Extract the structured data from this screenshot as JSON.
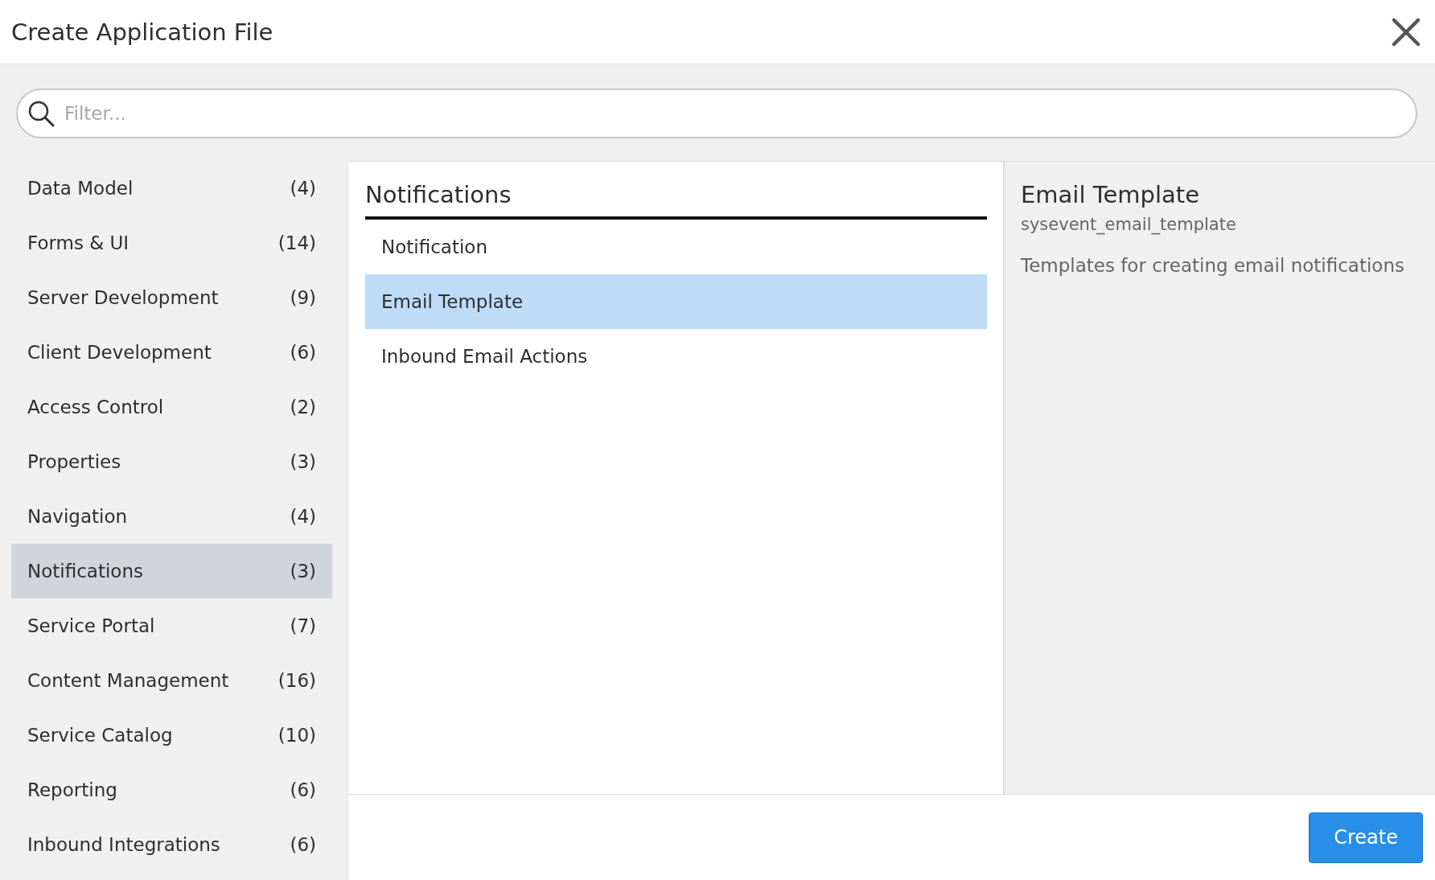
{
  "window": {
    "title": "Create Application File"
  },
  "search": {
    "placeholder": "Filter..."
  },
  "categories": [
    {
      "label": "Data Model",
      "count": "(4)",
      "selected": false
    },
    {
      "label": "Forms & UI",
      "count": "(14)",
      "selected": false
    },
    {
      "label": "Server Development",
      "count": "(9)",
      "selected": false
    },
    {
      "label": "Client Development",
      "count": "(6)",
      "selected": false
    },
    {
      "label": "Access Control",
      "count": "(2)",
      "selected": false
    },
    {
      "label": "Properties",
      "count": "(3)",
      "selected": false
    },
    {
      "label": "Navigation",
      "count": "(4)",
      "selected": false
    },
    {
      "label": "Notifications",
      "count": "(3)",
      "selected": true
    },
    {
      "label": "Service Portal",
      "count": "(7)",
      "selected": false
    },
    {
      "label": "Content Management",
      "count": "(16)",
      "selected": false
    },
    {
      "label": "Service Catalog",
      "count": "(10)",
      "selected": false
    },
    {
      "label": "Reporting",
      "count": "(6)",
      "selected": false
    },
    {
      "label": "Inbound Integrations",
      "count": "(6)",
      "selected": false
    }
  ],
  "file_types": {
    "heading": "Notifications",
    "items": [
      {
        "label": "Notification",
        "selected": false
      },
      {
        "label": "Email Template",
        "selected": true
      },
      {
        "label": "Inbound Email Actions",
        "selected": false
      }
    ]
  },
  "details": {
    "title": "Email Template",
    "table": "sysevent_email_template",
    "description": "Templates for creating email notifications"
  },
  "buttons": [
    {
      "label": "Create"
    }
  ]
}
